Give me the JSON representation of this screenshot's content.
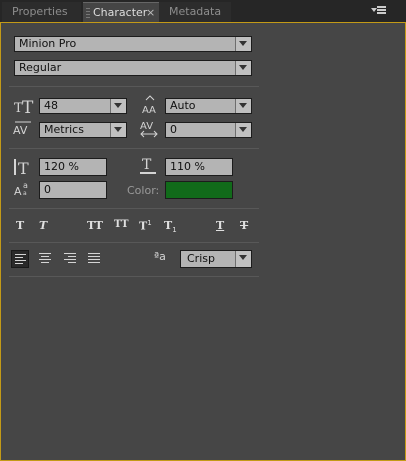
{
  "tabs": [
    {
      "label": "Properties"
    },
    {
      "label": "Character",
      "active": true
    },
    {
      "label": "Metadata"
    }
  ],
  "tab_close": "×",
  "font": {
    "family": "Minion Pro",
    "style": "Regular"
  },
  "size": {
    "value": "48",
    "leading": "Auto"
  },
  "kerning": {
    "value": "Metrics",
    "tracking": "0"
  },
  "scale": {
    "vertical": "120 %",
    "horizontal": "110 %"
  },
  "baseline_shift": "0",
  "color": {
    "label": "Color:",
    "fill": "#116b1a"
  },
  "style_buttons": {
    "bold": "T",
    "italic": "T",
    "all_caps": "TT",
    "small_caps": "TT",
    "superscript": "T",
    "subscript": "T",
    "underline": "T",
    "strikethrough": "T"
  },
  "superscript_mark": "1",
  "subscript_mark": "1",
  "antialias": {
    "icon_text": "ªa",
    "value": "Crisp"
  },
  "icons": {
    "font_size": "size-icon",
    "leading": "leading-icon",
    "kerning": "kerning-icon",
    "tracking": "tracking-icon",
    "vertical_scale": "vertical-scale-icon",
    "horizontal_scale": "horizontal-scale-icon",
    "baseline_shift": "baseline-shift-icon"
  },
  "colors": {
    "accent_border": "#c39a17",
    "panel_bg": "#464646",
    "field_bg": "#b4b4b4"
  }
}
